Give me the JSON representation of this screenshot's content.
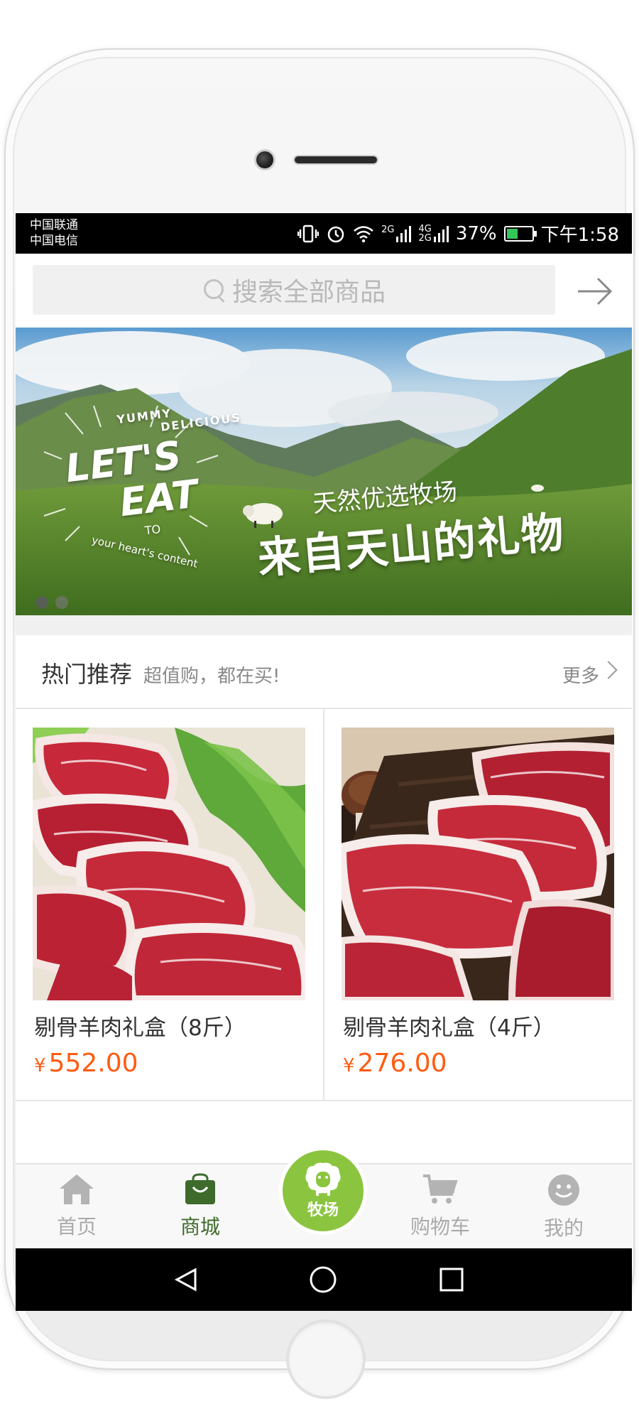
{
  "status_bar": {
    "carrier_1": "中国联通",
    "carrier_2": "中国电信",
    "network_1": "2G",
    "network_2": "4G",
    "network_3": "2G",
    "battery_percent": "37%",
    "time": "下午1:58"
  },
  "search": {
    "placeholder": "搜索全部商品"
  },
  "banner": {
    "en_yummy": "YUMMY",
    "en_delicious": "DELICIOUS",
    "en_lets": "LET'S",
    "en_eat": "EAT",
    "en_to": "TO",
    "en_hearts": "your heart's content",
    "cn_subtitle": "天然优选牧场",
    "cn_title": "来自天山的礼物",
    "slide_count": 2,
    "active_slide": 1
  },
  "hot_section": {
    "title": "热门推荐",
    "subtitle": "超值购，都在买!",
    "more_label": "更多"
  },
  "products": [
    {
      "name": "剔骨羊肉礼盒（8斤）",
      "currency": "¥",
      "price": "552.00"
    },
    {
      "name": "剔骨羊肉礼盒（4斤）",
      "currency": "¥",
      "price": "276.00"
    }
  ],
  "bottom_nav": {
    "home": "首页",
    "shop": "商城",
    "ranch": "牧场",
    "cart": "购物车",
    "mine": "我的"
  },
  "colors": {
    "accent_green": "#8bc53f",
    "active_tab": "#3e6b2c",
    "price": "#ff5b12"
  }
}
